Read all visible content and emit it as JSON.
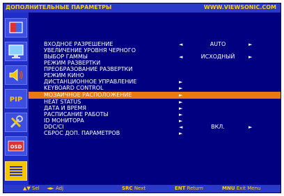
{
  "header": {
    "title": "ДОПОЛНИТЕЛЬНЫЕ ПАРАМЕТРЫ",
    "site": "WWW.VIEWSONIC.COM"
  },
  "sidebar": {
    "items": [
      {
        "icon": "picture-icon",
        "active": false
      },
      {
        "icon": "monitor-icon",
        "active": false
      },
      {
        "icon": "audio-icon",
        "active": false
      },
      {
        "icon": "pip-icon",
        "label": "PIP",
        "active": false
      },
      {
        "icon": "tools-icon",
        "active": false
      },
      {
        "icon": "osd-icon",
        "label": "OSD",
        "active": false
      },
      {
        "icon": "advanced-menu-icon",
        "active": true
      }
    ]
  },
  "menu": {
    "items": [
      {
        "label": "ВХОДНОЕ РАЗРЕШЕНИЕ",
        "left": "◄",
        "value": "AUTO",
        "right": "►"
      },
      {
        "label": "УВЕЛИЧЕНИЕ УРОВНЯ ЧЕРНОГО",
        "left": "",
        "value": "",
        "right": ""
      },
      {
        "label": "ВЫБОР ГАММЫ",
        "left": "◄",
        "value": "ИСХОДНЫЙ",
        "right": "►"
      },
      {
        "label": "РЕЖИМ РАЗВЕРТКИ",
        "left": "",
        "value": "",
        "right": ""
      },
      {
        "label": "ПРЕОБРАЗОВАНИЕ РАЗВЕРТКИ",
        "left": "",
        "value": "",
        "right": ""
      },
      {
        "label": "РЕЖИМ КИНО",
        "left": "",
        "value": "",
        "right": ""
      },
      {
        "label": "ДИСТАНЦИОННОЕ УПРАВЛЕНИЕ",
        "sub": "►"
      },
      {
        "label": "KEYBOARD CONTROL",
        "sub": "►"
      },
      {
        "label": "МОЗАИЧНОЕ РАСПОЛОЖЕНИЕ",
        "sub": "►",
        "selected": true
      },
      {
        "label": "HEAT STATUS",
        "sub": "►"
      },
      {
        "label": "ДАТА И ВРЕМЯ",
        "sub": "►"
      },
      {
        "label": "РАСПИСАНИЕ РАБОТЫ",
        "sub": "►"
      },
      {
        "label": "ID МОНИТОРА",
        "sub": "►"
      },
      {
        "label": "DDC/CI",
        "left": "◄",
        "value": "ВКЛ.",
        "right": "►"
      },
      {
        "label": "СБРОС ДОП. ПАРАМЕТРОВ",
        "sub": "►"
      }
    ]
  },
  "footer": {
    "sel_key": "▲▼",
    "sel_text": "Sel",
    "adj_key": "◄►",
    "adj_text": "Adj",
    "next_key": "SRC",
    "next_text": "Next",
    "return_key": "ENT",
    "return_text": "Return",
    "exit_key": "MNU",
    "exit_text": "Exit Menu"
  },
  "colors": {
    "background": "#000080",
    "bar": "#2b39c8",
    "highlight": "#ea7a10",
    "accent_text": "#ffd200"
  }
}
